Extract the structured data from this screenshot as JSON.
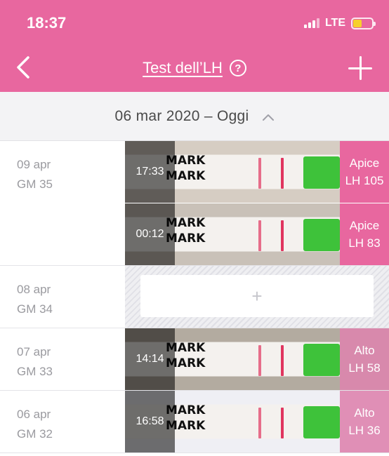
{
  "status_bar": {
    "time": "18:37",
    "network": "LTE"
  },
  "nav": {
    "title": "Test dell’LH",
    "help_glyph": "?"
  },
  "range": {
    "label": "06 mar 2020 – Oggi"
  },
  "days": [
    {
      "date": "09 apr",
      "cycle_day": "GM 35",
      "entries": [
        {
          "time": "17:33",
          "level": "Apice",
          "lh": "LH 105",
          "badge_color": "#e8679f",
          "strip_bg": "#d6cdc3"
        },
        {
          "time": "00:12",
          "level": "Apice",
          "lh": "LH 83",
          "badge_color": "#e8679f",
          "strip_bg": "#c9c1b8"
        }
      ]
    },
    {
      "date": "08 apr",
      "cycle_day": "GM 34",
      "empty_plus": "+"
    },
    {
      "date": "07 apr",
      "cycle_day": "GM 33",
      "entries": [
        {
          "time": "14:14",
          "level": "Alto",
          "lh": "LH 58",
          "badge_color": "#d889ac",
          "strip_bg": "#b3aba0"
        }
      ]
    },
    {
      "date": "06 apr",
      "cycle_day": "GM 32",
      "entries": [
        {
          "time": "16:58",
          "level": "Alto",
          "lh": "LH 36",
          "badge_color": "#e08fb6",
          "strip_bg": "#efeff4"
        }
      ]
    }
  ],
  "strip_mark_text": "MARK",
  "colors": {
    "header": "#e8679f",
    "test_line": "#e0355f",
    "pad": "#3ec23a"
  }
}
